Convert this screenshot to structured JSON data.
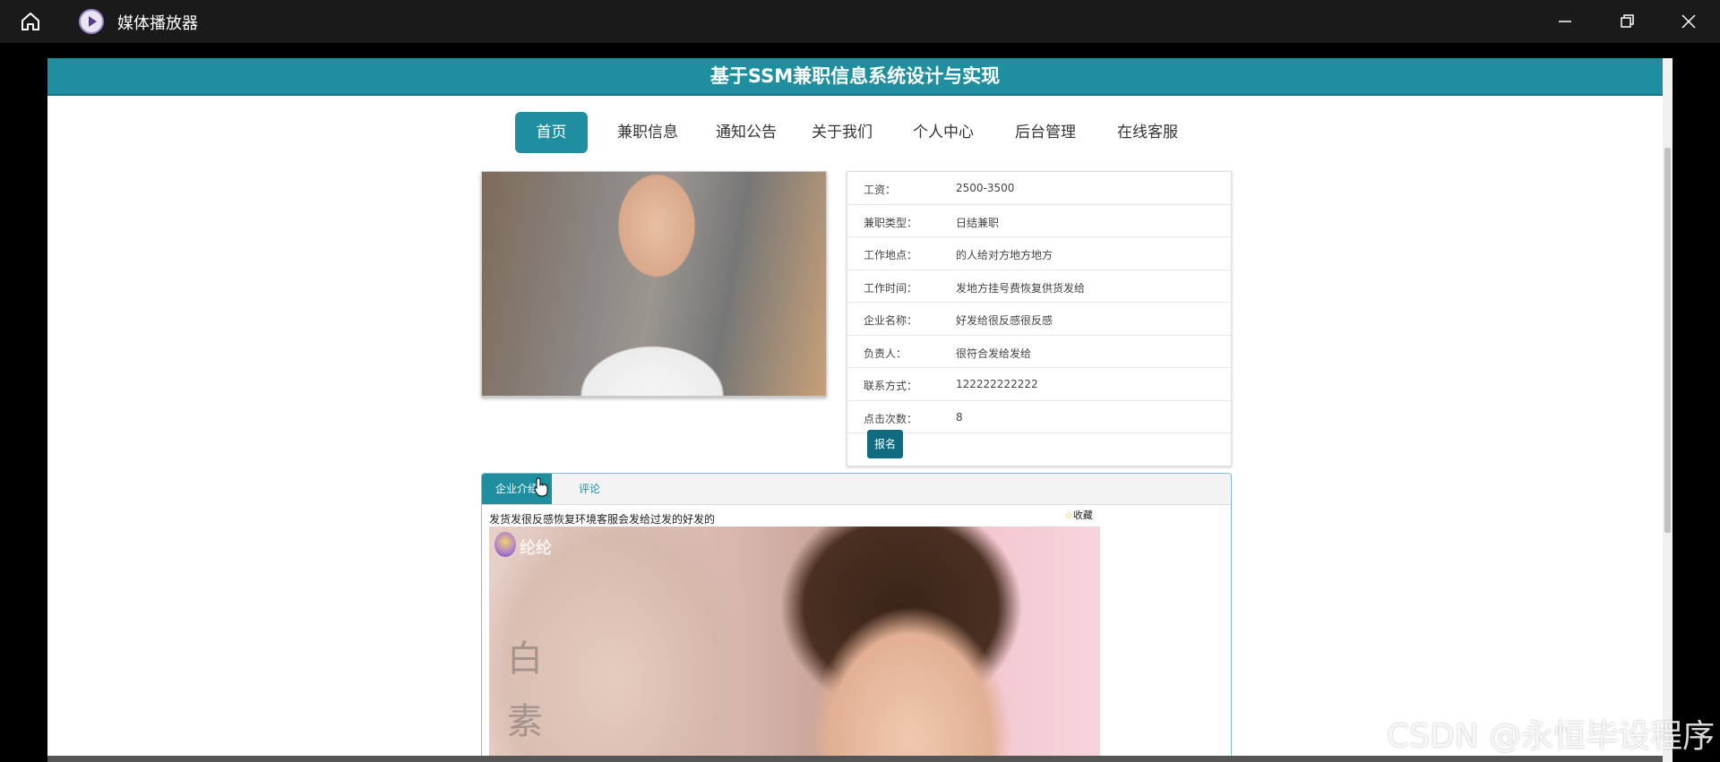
{
  "titlebar": {
    "app_title": "媒体播放器"
  },
  "site": {
    "title": "基于SSM兼职信息系统设计与实现"
  },
  "nav": {
    "items": [
      {
        "label": "首页",
        "active": true
      },
      {
        "label": "兼职信息",
        "active": false
      },
      {
        "label": "通知公告",
        "active": false
      },
      {
        "label": "关于我们",
        "active": false
      },
      {
        "label": "个人中心",
        "active": false
      },
      {
        "label": "后台管理",
        "active": false
      },
      {
        "label": "在线客服",
        "active": false
      }
    ]
  },
  "details": {
    "rows": [
      {
        "label": "工资：",
        "value": "2500-3500"
      },
      {
        "label": "兼职类型：",
        "value": "日结兼职"
      },
      {
        "label": "工作地点：",
        "value": "的人给对方地方地方"
      },
      {
        "label": "工作时间：",
        "value": "发地方挂号费恢复供货发给"
      },
      {
        "label": "企业名称：",
        "value": "好发给很反感很反感"
      },
      {
        "label": "负责人：",
        "value": "很符合发给发给"
      },
      {
        "label": "联系方式：",
        "value": "122222222222"
      },
      {
        "label": "点击次数：",
        "value": "8"
      }
    ],
    "signup_label": "报名"
  },
  "tabs": {
    "items": [
      {
        "label": "企业介绍"
      },
      {
        "label": "评论"
      }
    ],
    "content_text": "发货发很反感恢复环境客服会发给过发的好发的",
    "favorite_label": "收藏",
    "video_logo_text": "纶纶",
    "video_chars": [
      "白",
      "素"
    ]
  },
  "watermark": "CSDN @永恒毕设程序",
  "colors": {
    "accent": "#1f8fa0",
    "dark_accent": "#0e6b80",
    "titlebar": "#1a1a1a"
  }
}
